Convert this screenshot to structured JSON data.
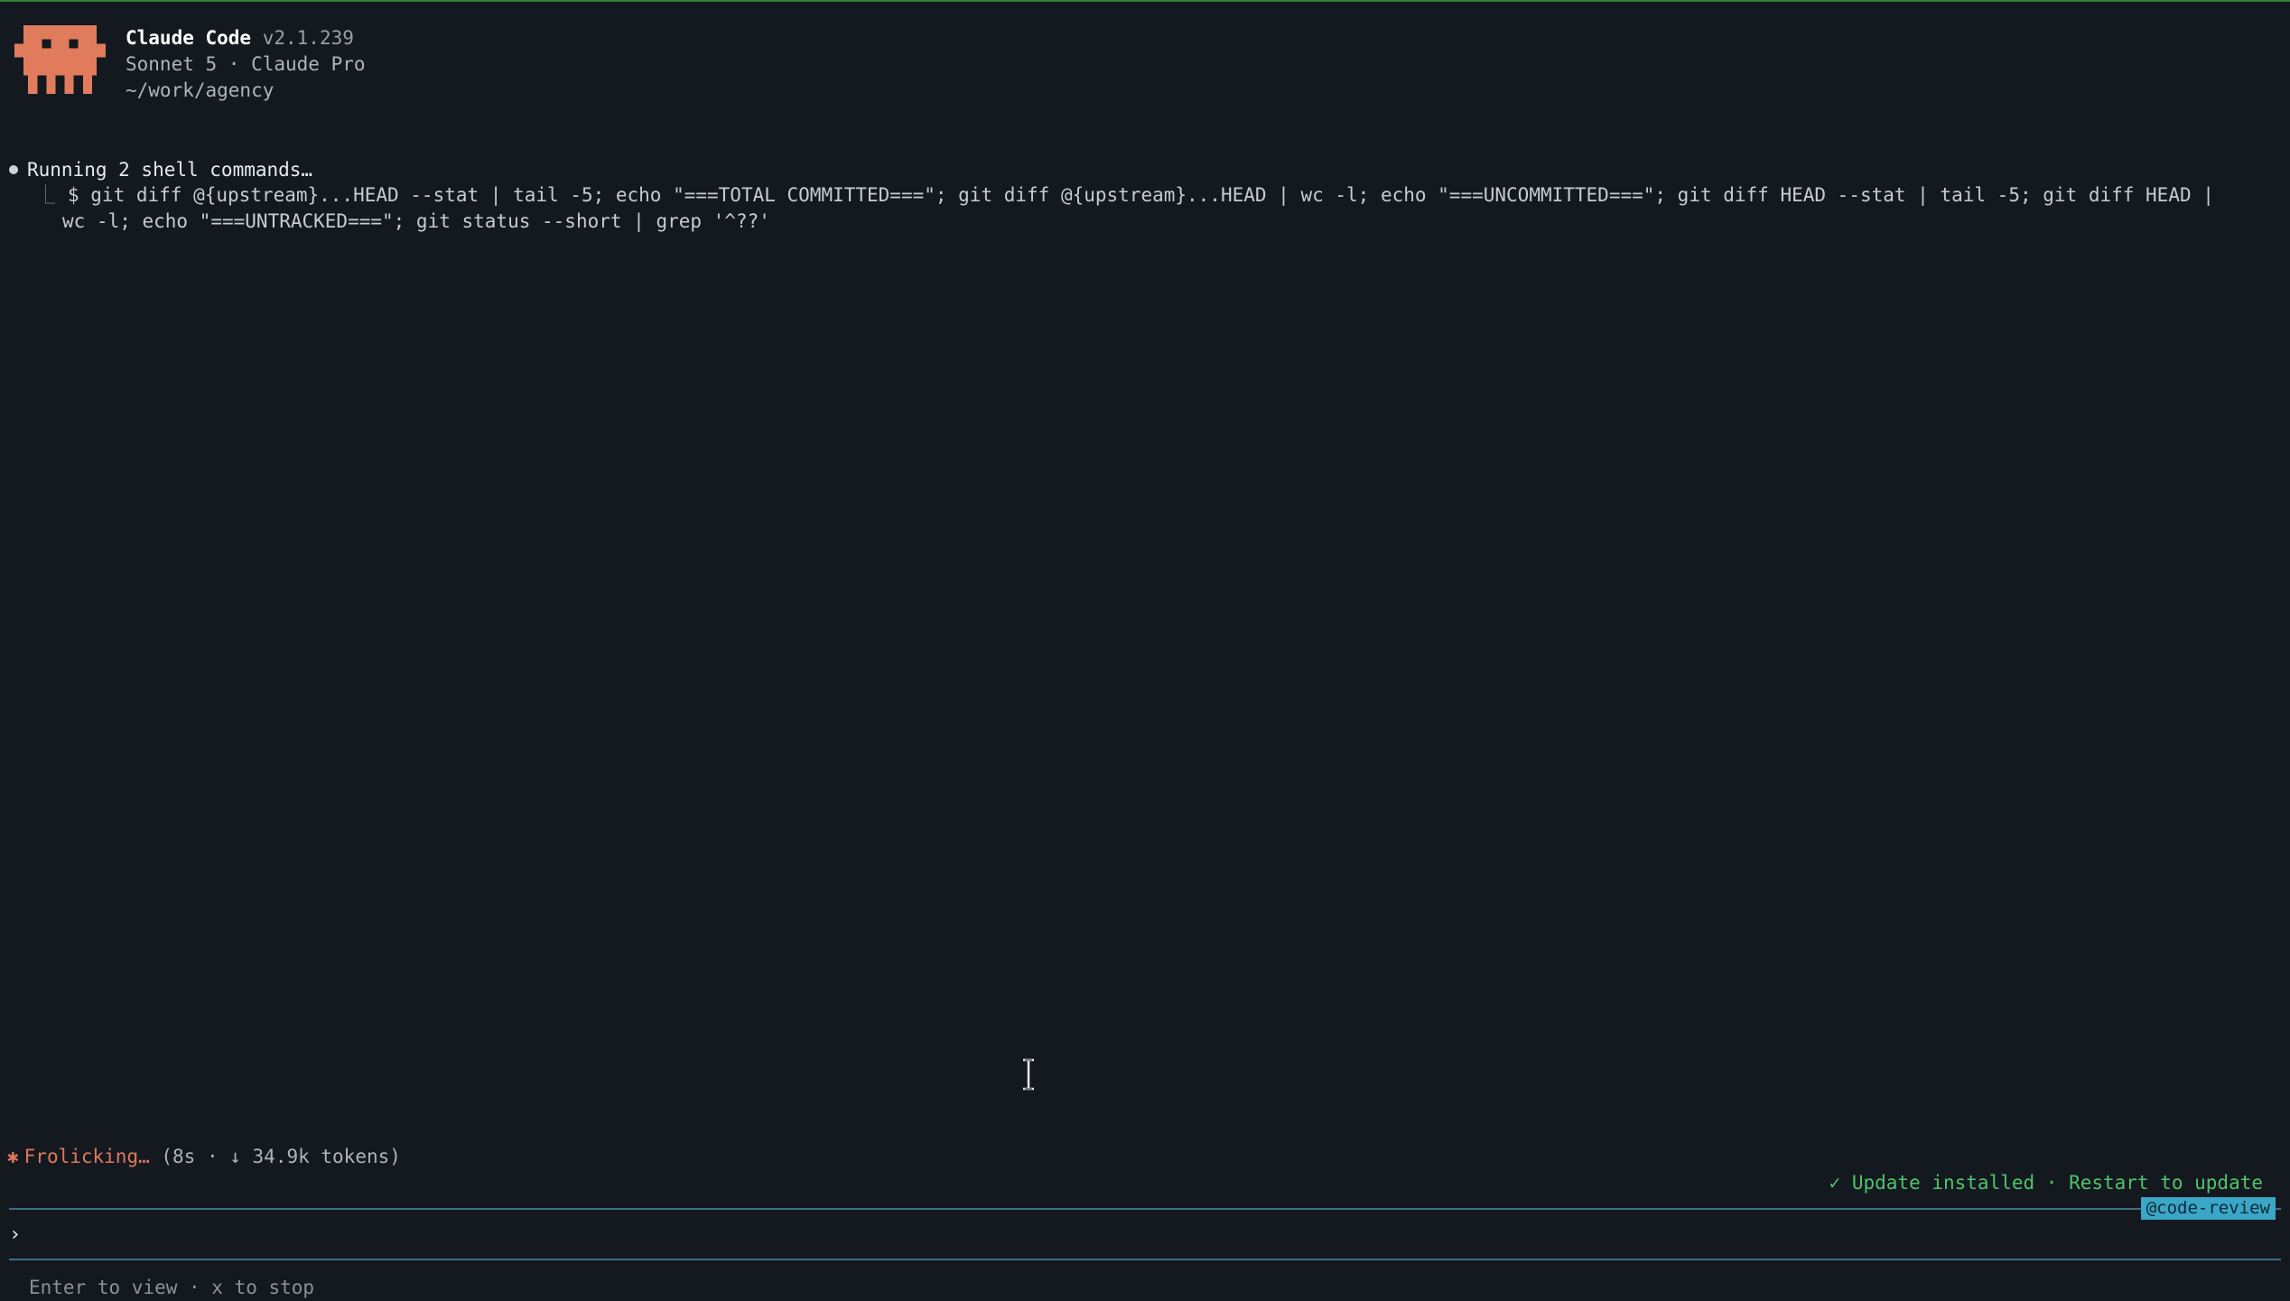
{
  "header": {
    "app_name": "Claude Code",
    "version": "v2.1.239",
    "model_plan": "Sonnet 5 · Claude Pro",
    "cwd": "~/work/agency",
    "logo_icon": "claude-pixel-mascot-icon",
    "logo_color": "#e07c5c"
  },
  "activity": {
    "running_label": "Running 2 shell commands…",
    "command": "$ git diff @{upstream}...HEAD --stat | tail -5; echo \"===TOTAL COMMITTED===\"; git diff @{upstream}...HEAD | wc -l; echo \"===UNCOMMITTED===\"; git diff HEAD --stat | tail -5; git diff HEAD | wc -l; echo \"===UNTRACKED===\"; git status --short | grep '^??'",
    "elbow": "⎿"
  },
  "status": {
    "star": "✱",
    "verb": "Frolicking…",
    "details": "(8s · ↓ 34.9k tokens)"
  },
  "update_notice": "✓ Update installed · Restart to update",
  "agent_badge": "@code-review",
  "prompt": {
    "symbol": "›",
    "value": "",
    "placeholder": ""
  },
  "hint": "Enter to view · x to stop",
  "colors": {
    "background": "#141920",
    "accent": "#e0785a",
    "success": "#4fc36b",
    "rule": "#3d6e82",
    "badge": "#3aa6c8"
  }
}
